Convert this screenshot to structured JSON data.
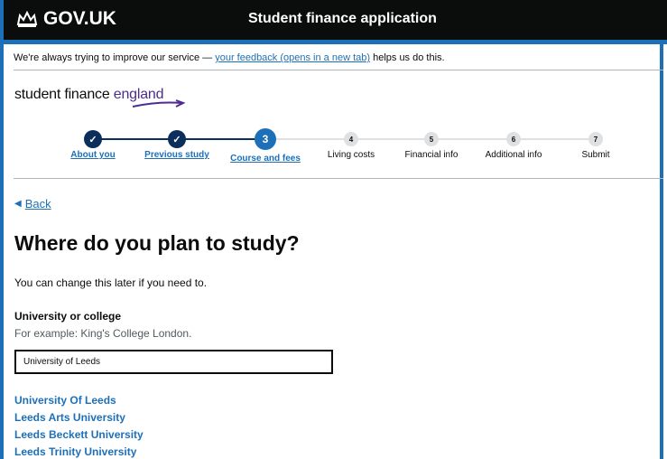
{
  "header": {
    "logo_text": "GOV.UK",
    "service_name": "Student finance application"
  },
  "feedback": {
    "prefix": "We're always trying to improve our service — ",
    "link": "your feedback (opens in a new tab)",
    "suffix": " helps us do this."
  },
  "brand": {
    "part1": "student finance ",
    "part2": "england"
  },
  "steps": [
    {
      "number": "✓",
      "label": "About you",
      "state": "done"
    },
    {
      "number": "✓",
      "label": "Previous study",
      "state": "done"
    },
    {
      "number": "3",
      "label": "Course and fees",
      "state": "current"
    },
    {
      "number": "4",
      "label": "Living costs",
      "state": "todo"
    },
    {
      "number": "5",
      "label": "Financial info",
      "state": "todo"
    },
    {
      "number": "6",
      "label": "Additional info",
      "state": "todo"
    },
    {
      "number": "7",
      "label": "Submit",
      "state": "todo"
    }
  ],
  "back": {
    "label": "Back"
  },
  "page": {
    "title": "Where do you plan to study?",
    "intro": "You can change this later if you need to."
  },
  "field": {
    "label": "University or college",
    "hint": "For example: King's College London.",
    "value": "University of Leeds"
  },
  "suggestions": [
    "University Of Leeds",
    "Leeds Arts University",
    "Leeds Beckett University",
    "Leeds Trinity University"
  ],
  "colors": {
    "link": "#1d70b8",
    "step_done": "#0b2e5c",
    "step_current": "#1d70b8",
    "step_todo": "#dee0e2"
  }
}
